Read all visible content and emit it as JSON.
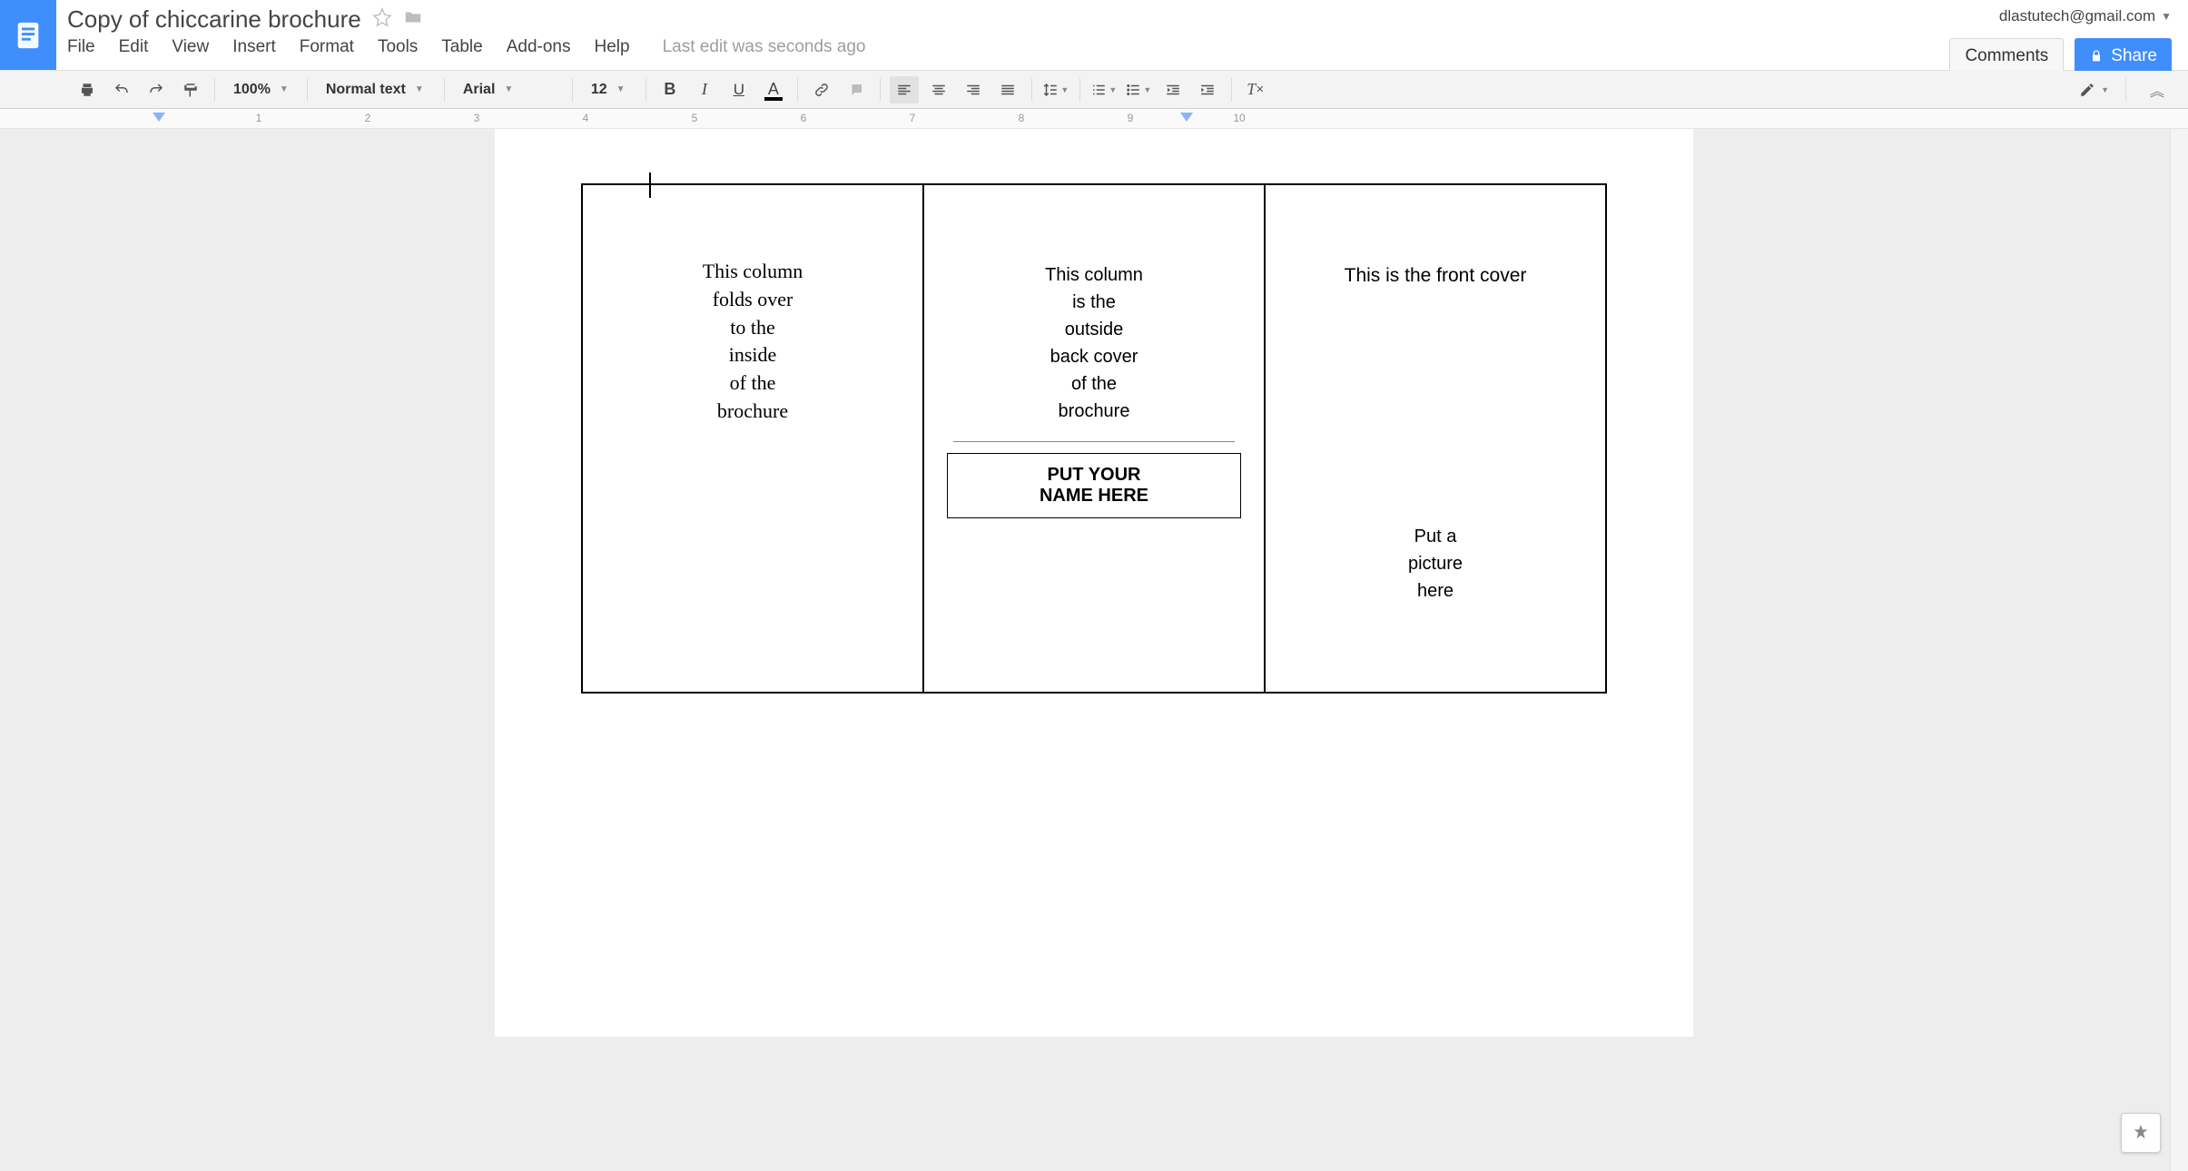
{
  "header": {
    "doc_title": "Copy of chiccarine brochure",
    "user_email": "dlastutech@gmail.com",
    "comments_label": "Comments",
    "share_label": "Share"
  },
  "menu": {
    "file": "File",
    "edit": "Edit",
    "view": "View",
    "insert": "Insert",
    "format": "Format",
    "tools": "Tools",
    "table": "Table",
    "addons": "Add-ons",
    "help": "Help",
    "last_edit": "Last edit was seconds ago"
  },
  "toolbar": {
    "zoom": "100%",
    "style": "Normal text",
    "font": "Arial",
    "font_size": "12"
  },
  "ruler": {
    "numbers": [
      "1",
      "2",
      "3",
      "4",
      "5",
      "6",
      "7",
      "8",
      "9",
      "10"
    ]
  },
  "document": {
    "col1": "This column\nfolds over\nto the\ninside\nof the\nbrochure",
    "col2_top": "This column\nis the\noutside\nback cover\nof the\nbrochure",
    "col2_name_box": "PUT YOUR\nNAME HERE",
    "col3_title": "This is the front cover",
    "col3_pic": "Put a\npicture\nhere"
  }
}
